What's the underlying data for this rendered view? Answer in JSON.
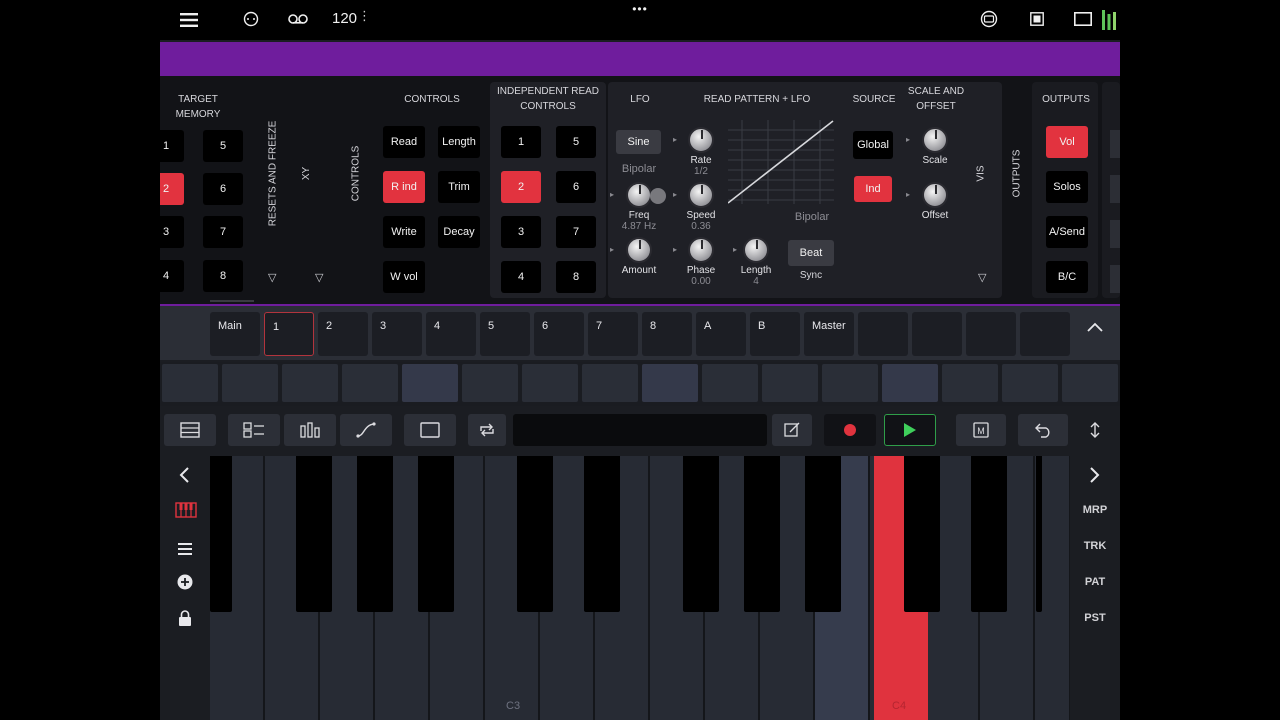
{
  "topbar": {
    "bpm": "120",
    "bpm_dots": "⋮",
    "handle": "•••"
  },
  "module": {
    "target_memory": {
      "title": "TARGET MEMORY",
      "left_col": [
        "1",
        "2",
        "3",
        "4"
      ],
      "right_col": [
        "5",
        "6",
        "7",
        "8"
      ],
      "selected": "2"
    },
    "resets_label": "RESETS AND FREEZE",
    "xy_label": "XY",
    "controls_vlabel": "CONTROLS",
    "controls": {
      "title": "CONTROLS",
      "buttons": [
        "Read",
        "Length",
        "R ind",
        "Trim",
        "Write",
        "Decay",
        "W vol"
      ]
    },
    "independent": {
      "title_line1": "INDEPENDENT READ",
      "title_line2": "CONTROLS",
      "left_col": [
        "1",
        "2",
        "3",
        "4"
      ],
      "right_col": [
        "5",
        "6",
        "7",
        "8"
      ]
    },
    "lfo": {
      "title": "LFO",
      "shape": "Sine",
      "mode": "Bipolar",
      "freq_label": "Freq",
      "freq_value": "4.87 Hz",
      "amount_label": "Amount"
    },
    "read_pattern": {
      "title": "READ PATTERN + LFO",
      "rate_label": "Rate",
      "rate_value": "1/2",
      "speed_label": "Speed",
      "speed_value": "0.36",
      "phase_label": "Phase",
      "phase_value": "0.00",
      "length_label": "Length",
      "length_value": "4",
      "graph_mode": "Bipolar",
      "beat": "Beat",
      "sync": "Sync"
    },
    "source": {
      "title": "SOURCE",
      "global": "Global",
      "ind": "Ind"
    },
    "scale_offset": {
      "title_line1": "SCALE AND",
      "title_line2": "OFFSET",
      "scale_label": "Scale",
      "offset_label": "Offset"
    },
    "vis_label": "VIS",
    "outputs_vlabel": "OUTPUTS",
    "outputs": {
      "title": "OUTPUTS",
      "buttons": [
        "Vol",
        "Solos",
        "A/Send",
        "B/C"
      ]
    },
    "tri": "▽"
  },
  "tracks": [
    "Main",
    "1",
    "2",
    "3",
    "4",
    "5",
    "6",
    "7",
    "8",
    "A",
    "B",
    "Master",
    "",
    "",
    "",
    ""
  ],
  "keyboard": {
    "left_note": "C3",
    "right_note": "C4",
    "right_nav": [
      "MRP",
      "TRK",
      "PAT",
      "PST"
    ]
  },
  "colors": {
    "accent_red": "#e2333f",
    "purple": "#6f1d9d",
    "play_green": "#2f9e49"
  }
}
